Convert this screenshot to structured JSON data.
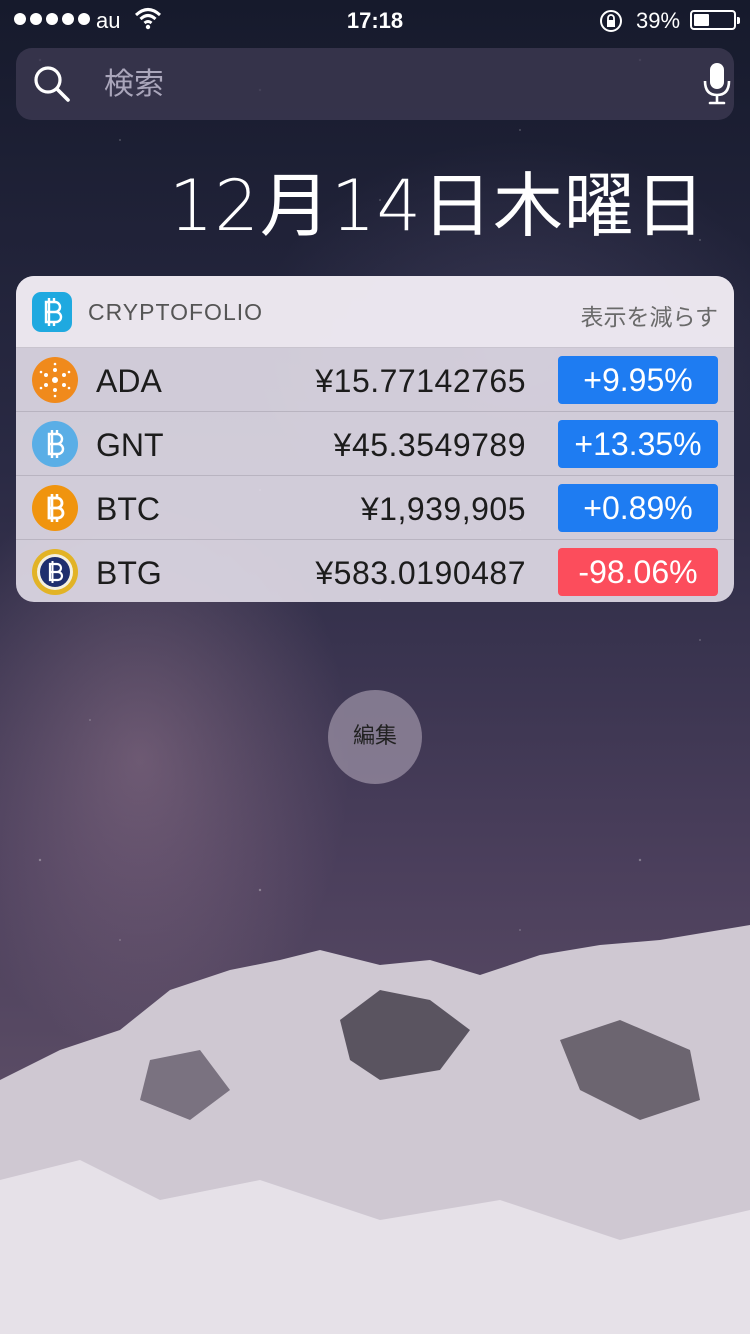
{
  "status_bar": {
    "carrier": "au",
    "time": "17:18",
    "battery_percent": "39%",
    "battery_level": 0.39,
    "icons": [
      "signal-dots-icon",
      "wifi-icon",
      "rotation-lock-icon",
      "battery-icon"
    ]
  },
  "search": {
    "placeholder": "検索",
    "value": "",
    "icons": [
      "search-icon",
      "mic-icon"
    ]
  },
  "date": "12月14日木曜日",
  "widget": {
    "app_name": "CRYPTOFOLIO",
    "app_icon": "bitcoin-app-icon",
    "show_less_label": "表示を減らす",
    "rows": [
      {
        "symbol": "ADA",
        "price": "¥15.77142765",
        "change": "+9.95%",
        "direction": "up",
        "icon": "cardano-icon"
      },
      {
        "symbol": "GNT",
        "price": "¥45.3549789",
        "change": "+13.35%",
        "direction": "up",
        "icon": "golem-icon"
      },
      {
        "symbol": "BTC",
        "price": "¥1,939,905",
        "change": "+0.89%",
        "direction": "up",
        "icon": "bitcoin-icon"
      },
      {
        "symbol": "BTG",
        "price": "¥583.0190487",
        "change": "-98.06%",
        "direction": "down",
        "icon": "bitcoin-gold-icon"
      }
    ]
  },
  "edit_button": {
    "label": "編集"
  },
  "colors": {
    "change_up": "#1e7cf2",
    "change_down": "#fc4d5c",
    "app_icon_bg": "#1fa9e0",
    "ada_icon": "#f08a1c",
    "gnt_icon": "#5aaee6",
    "btc_icon": "#f0940e",
    "btg_icon": "#e2b326"
  }
}
